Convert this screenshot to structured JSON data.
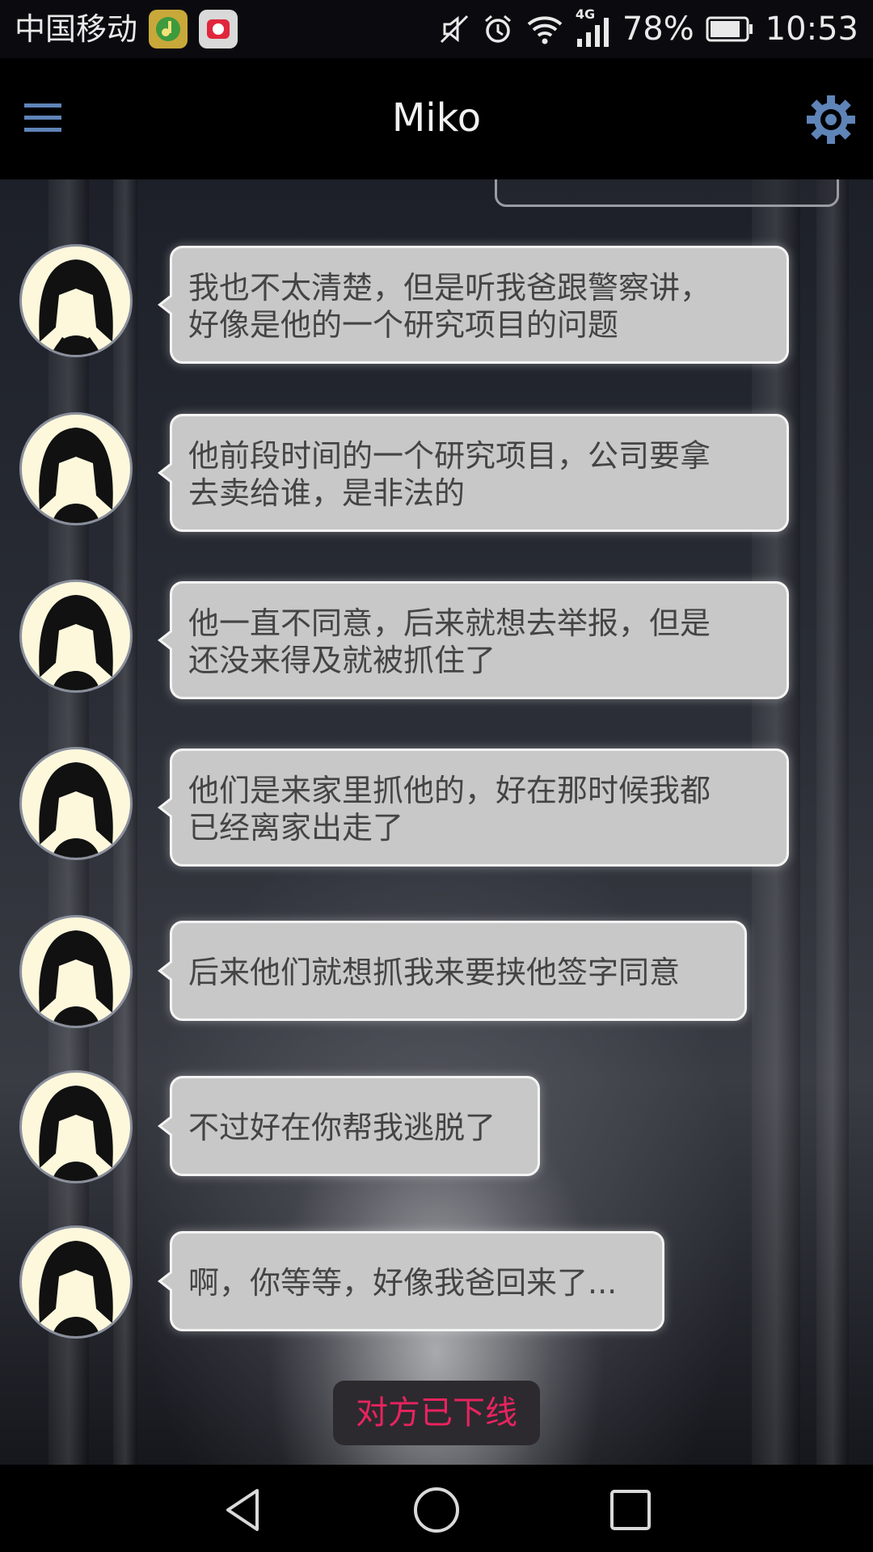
{
  "status_bar": {
    "carrier": "中国移动",
    "network": "4G",
    "battery": "78%",
    "time": "10:53",
    "icons": [
      "app-music-icon",
      "app-alarm-app-icon",
      "mute-icon",
      "alarm-icon",
      "wifi-icon",
      "signal-icon",
      "battery-icon"
    ]
  },
  "header": {
    "title": "Miko",
    "menu_icon": "menu-icon",
    "settings_icon": "gear-icon"
  },
  "messages": [
    {
      "sender": "Miko",
      "text_line1": "我也不太清楚，但是听我爸跟警察讲，",
      "text_line2": "好像是他的一个研究项目的问题"
    },
    {
      "sender": "Miko",
      "text_line1": "他前段时间的一个研究项目，公司要拿",
      "text_line2": "去卖给谁，是非法的"
    },
    {
      "sender": "Miko",
      "text_line1": "他一直不同意，后来就想去举报，但是",
      "text_line2": "还没来得及就被抓住了"
    },
    {
      "sender": "Miko",
      "text_line1": "他们是来家里抓他的，好在那时候我都",
      "text_line2": "已经离家出走了"
    },
    {
      "sender": "Miko",
      "text_line1": "后来他们就想抓我来要挟他签字同意",
      "text_line2": ""
    },
    {
      "sender": "Miko",
      "text_line1": "不过好在你帮我逃脱了",
      "text_line2": ""
    },
    {
      "sender": "Miko",
      "text_line1": "啊，你等等，好像我爸回来了...",
      "text_line2": ""
    }
  ],
  "status_notice": "对方已下线",
  "nav_bar": {
    "icons": [
      "back-icon",
      "home-icon",
      "recents-icon"
    ]
  },
  "colors": {
    "notice_text": "#e8235f",
    "bubble_bg": "#c8c8c8",
    "accent_icon": "#5f84b8"
  }
}
